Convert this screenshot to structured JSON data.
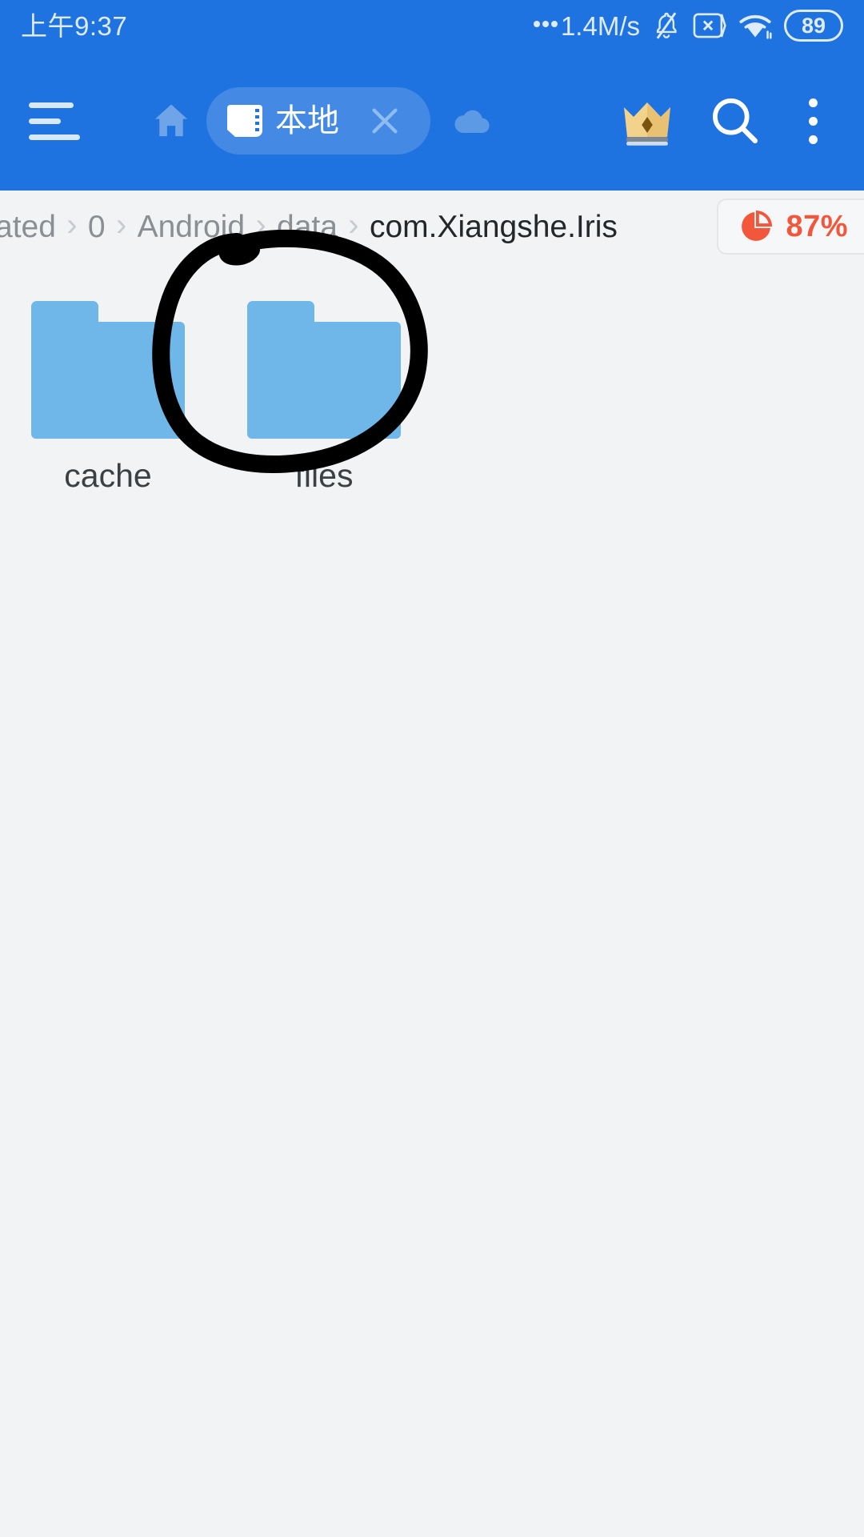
{
  "status_bar": {
    "time": "上午9:37",
    "network_speed": "1.4M/s",
    "battery_level": "89",
    "icons": [
      "ellipsis-icon",
      "bell-muted-icon",
      "sim-card-disabled-icon",
      "wifi-icon",
      "battery-icon"
    ]
  },
  "toolbar": {
    "menu_icon": "hamburger-menu-icon",
    "home_icon": "home-icon",
    "tab": {
      "icon": "sd-card-icon",
      "label": "本地",
      "close_icon": "close-icon"
    },
    "cloud_icon": "cloud-icon",
    "vip_icon": "crown-icon",
    "search_icon": "search-icon",
    "more_icon": "more-vertical-icon",
    "background_color": "#1F73E0"
  },
  "breadcrumb": {
    "separator": "›",
    "items": [
      {
        "label": "ated",
        "current": false,
        "clipped": true
      },
      {
        "label": "0",
        "current": false,
        "clipped": false
      },
      {
        "label": "Android",
        "current": false,
        "clipped": false
      },
      {
        "label": "data",
        "current": false,
        "clipped": false
      },
      {
        "label": "com.Xiangshe.Iris",
        "current": true,
        "clipped": false
      }
    ]
  },
  "storage": {
    "icon": "pie-chart-icon",
    "percent": "87%",
    "color": "#F2573B"
  },
  "files": [
    {
      "name": "cache",
      "type": "folder",
      "icon": "folder-icon"
    },
    {
      "name": "files",
      "type": "folder",
      "icon": "folder-icon"
    }
  ],
  "annotation": {
    "type": "hand-drawn-circle",
    "color": "#000000",
    "target": "files"
  },
  "colors": {
    "brand_blue": "#1F73E0",
    "folder_blue": "#6FB7E8",
    "page_background": "#F1F3F4",
    "text_primary": "#3C4043",
    "text_muted": "#8A8F94"
  }
}
